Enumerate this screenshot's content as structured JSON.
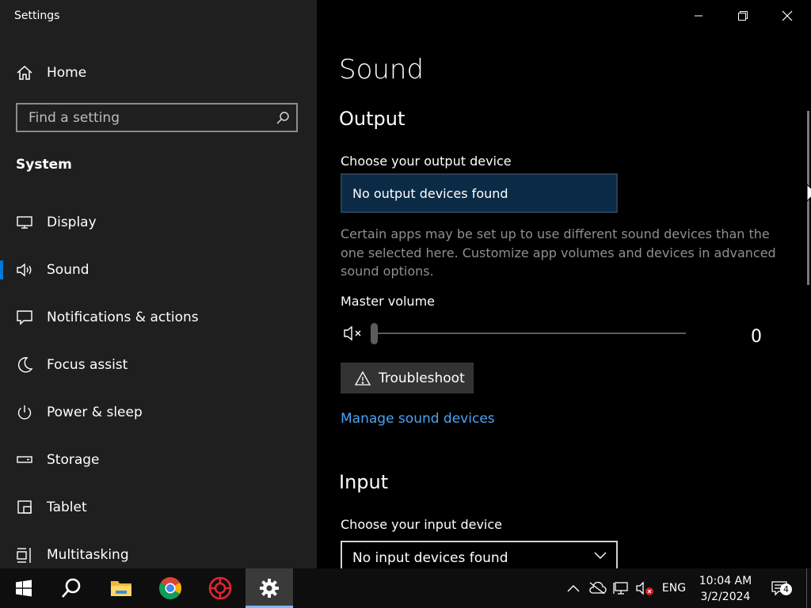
{
  "window": {
    "title": "Settings"
  },
  "sidebar": {
    "home_label": "Home",
    "search_placeholder": "Find a setting",
    "section_label": "System",
    "items": [
      {
        "label": "Display",
        "icon": "monitor-icon"
      },
      {
        "label": "Sound",
        "icon": "speaker-icon",
        "selected": true
      },
      {
        "label": "Notifications & actions",
        "icon": "notification-icon"
      },
      {
        "label": "Focus assist",
        "icon": "moon-icon"
      },
      {
        "label": "Power & sleep",
        "icon": "power-icon"
      },
      {
        "label": "Storage",
        "icon": "storage-icon"
      },
      {
        "label": "Tablet",
        "icon": "tablet-icon"
      },
      {
        "label": "Multitasking",
        "icon": "multitasking-icon"
      }
    ]
  },
  "main": {
    "page_title": "Sound",
    "output": {
      "heading": "Output",
      "device_label": "Choose your output device",
      "device_value": "No output devices found",
      "note": "Certain apps may be set up to use different sound devices than the one selected here. Customize app volumes and devices in advanced sound options.",
      "volume_label": "Master volume",
      "volume_value": "0",
      "troubleshoot_label": "Troubleshoot",
      "manage_link": "Manage sound devices"
    },
    "input": {
      "heading": "Input",
      "device_label": "Choose your input device",
      "device_value": "No input devices found"
    }
  },
  "taskbar": {
    "apps": [
      "start-icon",
      "search-icon",
      "file-explorer-icon",
      "chrome-icon",
      "app-icon",
      "settings-icon"
    ],
    "language": "ENG",
    "time": "10:04 AM",
    "date": "3/2/2024",
    "notification_count": "4"
  },
  "colors": {
    "accent": "#0078d7",
    "link": "#4aa3f5",
    "sidebar_bg": "#1f1f1f",
    "dropdown_selected_bg": "#0b2a45"
  }
}
